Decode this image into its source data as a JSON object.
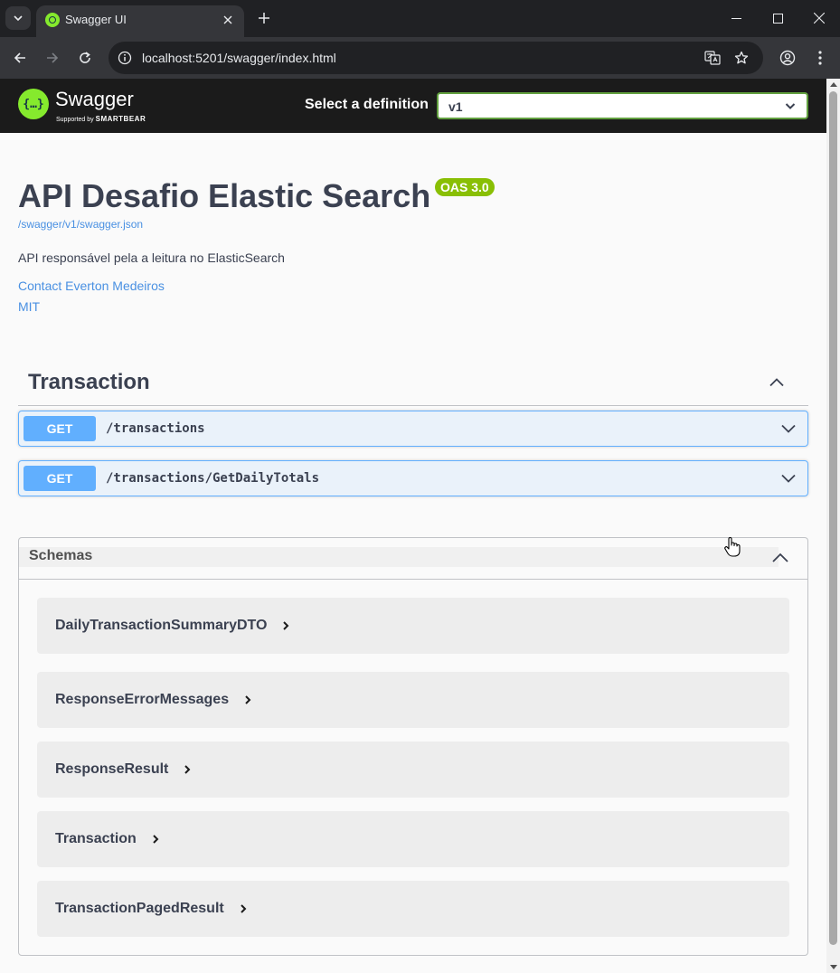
{
  "browser": {
    "tab_title": "Swagger UI",
    "url": "localhost:5201/swagger/index.html"
  },
  "topbar": {
    "logo_word": "Swagger",
    "logo_sub_prefix": "Supported by",
    "logo_sub_brand": "SMARTBEAR",
    "definition_label": "Select a definition",
    "definition_value": "v1"
  },
  "info": {
    "title": "API Desafio Elastic Search",
    "oas_badge": "OAS 3.0",
    "json_link": "/swagger/v1/swagger.json",
    "description": "API responsável pela a leitura no ElasticSearch",
    "contact": "Contact Everton Medeiros",
    "license": "MIT"
  },
  "tag": {
    "name": "Transaction",
    "operations": [
      {
        "method": "GET",
        "path": "/transactions"
      },
      {
        "method": "GET",
        "path": "/transactions/GetDailyTotals"
      }
    ]
  },
  "schemas": {
    "title": "Schemas",
    "models": [
      "DailyTransactionSummaryDTO",
      "ResponseErrorMessages",
      "ResponseResult",
      "Transaction",
      "TransactionPagedResult"
    ]
  },
  "colors": {
    "get_method": "#61affe",
    "oas_badge": "#89bf04",
    "link": "#4990e2",
    "topbar_bg": "#1b1b1b",
    "select_border": "#62a03f"
  }
}
